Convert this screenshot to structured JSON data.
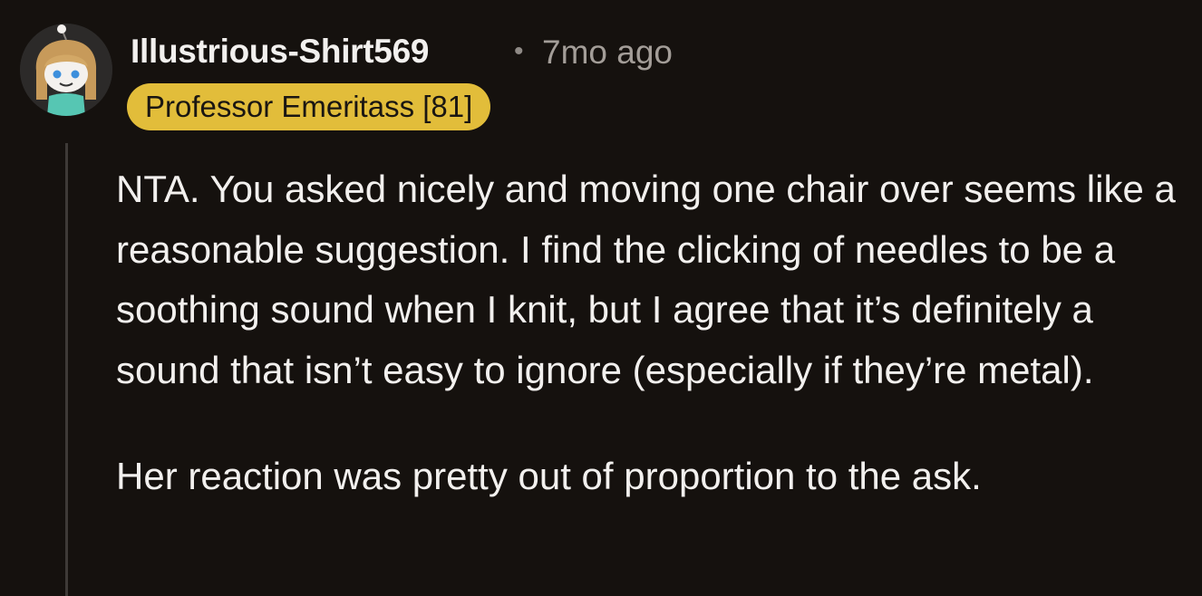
{
  "comment": {
    "author": "Illustrious-Shirt569",
    "separator": "•",
    "timestamp": "7mo ago",
    "flair": "Professor Emeritass [81]",
    "paragraphs": [
      "NTA. You asked nicely and moving one chair over seems like a reasonable suggestion. I find the clicking of needles to be a soothing sound when I knit, but I agree that it’s definitely a sound that isn’t easy to ignore (especially if they’re metal).",
      "Her reaction was pretty out of proportion to the ask."
    ],
    "avatar_icon": "snoo-avatar-icon"
  },
  "colors": {
    "background": "#15110e",
    "text": "#f2f0ee",
    "meta": "#a39d98",
    "flair_bg": "#e2bd3a",
    "flair_text": "#1a1612",
    "thread_line": "#3e3a37"
  }
}
